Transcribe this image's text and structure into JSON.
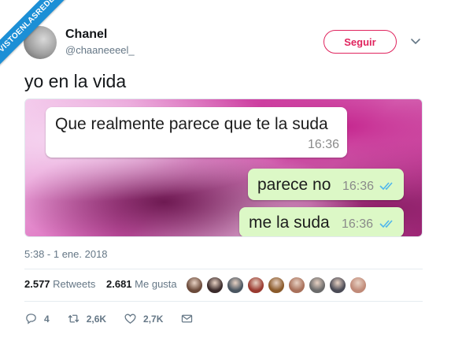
{
  "watermark": "VISTOENLASREDES",
  "user": {
    "name": "Chanel",
    "handle": "@chaaneeeel_"
  },
  "follow_label": "Seguir",
  "tweet": {
    "text": "yo en la vida",
    "timestamp": "5:38 - 1 ene. 2018"
  },
  "chat": {
    "incoming": {
      "text": "Que realmente parece que te la suda",
      "time": "16:36"
    },
    "outgoing": [
      {
        "text": "parece no",
        "time": "16:36"
      },
      {
        "text": "me la suda",
        "time": "16:36"
      }
    ]
  },
  "stats": {
    "retweets_count": "2.577",
    "retweets_label": "Retweets",
    "likes_count": "2.681",
    "likes_label": "Me gusta"
  },
  "likers": [
    {
      "icon": "avatar",
      "color": "#6b4a3a"
    },
    {
      "icon": "avatar",
      "color": "#3a2a2a"
    },
    {
      "icon": "avatar",
      "color": "#4a5560"
    },
    {
      "icon": "avatar",
      "color": "#9a3a30"
    },
    {
      "icon": "avatar",
      "color": "#8a5a2a"
    },
    {
      "icon": "avatar",
      "color": "#a8705a"
    },
    {
      "icon": "avatar",
      "color": "#6a6a6a"
    },
    {
      "icon": "avatar",
      "color": "#4a4a55"
    },
    {
      "icon": "avatar",
      "color": "#c08a78"
    }
  ],
  "actions": {
    "replies": "4",
    "retweets": "2,6K",
    "likes": "2,7K"
  },
  "colors": {
    "accent": "#e0245e",
    "muted": "#657786",
    "tick_blue": "#4fb6ec",
    "ribbon": "#1c8fd6"
  }
}
